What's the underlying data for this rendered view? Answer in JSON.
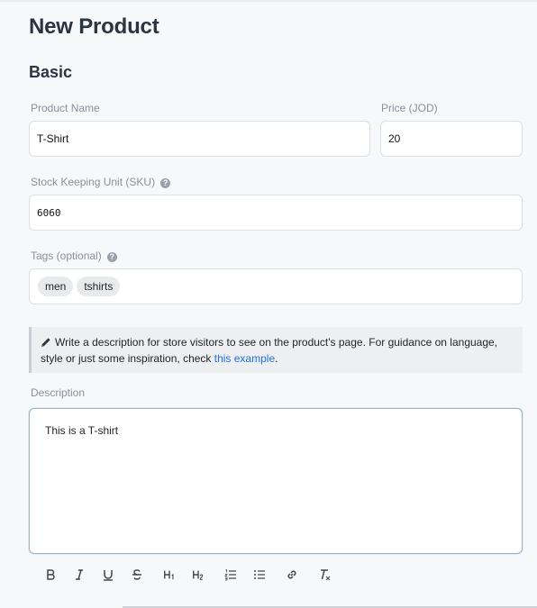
{
  "page": {
    "title": "New Product"
  },
  "section": {
    "title": "Basic"
  },
  "fields": {
    "product_name": {
      "label": "Product Name",
      "value": "T-Shirt"
    },
    "price": {
      "label": "Price (JOD)",
      "value": "20"
    },
    "sku": {
      "label": "Stock Keeping Unit (SKU)",
      "value": "6060"
    },
    "tags": {
      "label": "Tags (optional)",
      "items": [
        "men",
        "tshirts"
      ]
    }
  },
  "note": {
    "text": "Write a description for store visitors to see on the product's page. For guidance on language, style or just some inspiration, check ",
    "link_text": "this example",
    "after": "."
  },
  "description": {
    "label": "Description",
    "value": "This is a T-shirt"
  },
  "toolbar": {
    "buttons": [
      "bold-icon",
      "italic-icon",
      "underline-icon",
      "strikethrough-icon",
      "heading1-icon",
      "heading2-icon",
      "ordered-list-icon",
      "bullet-list-icon",
      "link-icon",
      "clear-format-icon"
    ]
  }
}
